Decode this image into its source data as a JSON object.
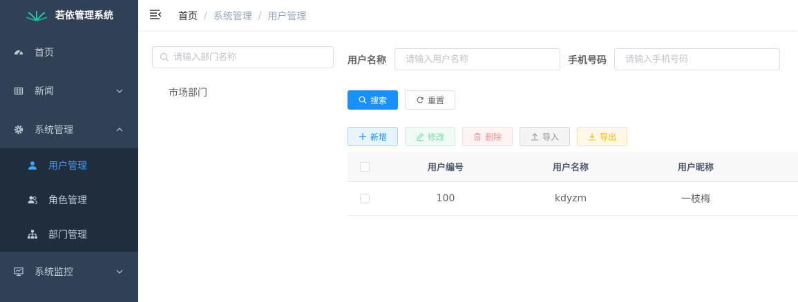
{
  "app": {
    "title": "若依管理系统"
  },
  "sidebar": {
    "items": [
      {
        "label": "首页",
        "icon": "dashboard-icon"
      },
      {
        "label": "新闻",
        "icon": "table-icon"
      },
      {
        "label": "系统管理",
        "icon": "system-gear-icon"
      },
      {
        "label": "系统监控",
        "icon": "monitor-icon"
      }
    ],
    "submenu": [
      {
        "label": "用户管理",
        "icon": "user-icon",
        "active": true
      },
      {
        "label": "角色管理",
        "icon": "peoples-icon"
      },
      {
        "label": "部门管理",
        "icon": "tree-icon"
      }
    ]
  },
  "breadcrumb": [
    "首页",
    "系统管理",
    "用户管理"
  ],
  "dept": {
    "placeholder": "请输入部门名称",
    "nodes": [
      "市场部门"
    ]
  },
  "form": {
    "username_label": "用户名称",
    "username_placeholder": "请输入用户名称",
    "phone_label": "手机号码",
    "phone_placeholder": "请输入手机号码",
    "search_label": "搜索",
    "reset_label": "重置"
  },
  "toolbar": {
    "add": "新增",
    "edit": "修改",
    "delete": "删除",
    "import": "导入",
    "export": "导出"
  },
  "table": {
    "headers": [
      "用户编号",
      "用户名称",
      "用户昵称"
    ],
    "rows": [
      [
        "100",
        "kdyzm",
        "一枝梅"
      ]
    ]
  },
  "colors": {
    "sidebar_bg": "#304156",
    "submenu_bg": "#1f2d3d",
    "active": "#409eff",
    "primary": "#1890ff"
  }
}
